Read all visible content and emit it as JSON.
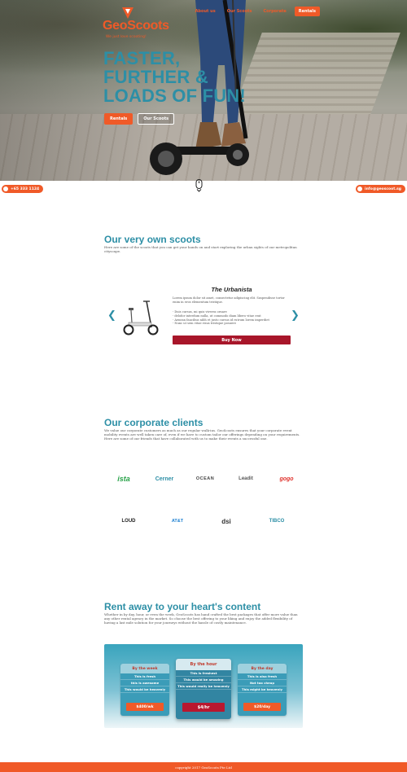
{
  "brand": {
    "name": "GeoScoots",
    "tagline": "We just love scooting!"
  },
  "nav": {
    "about": "About us",
    "scoots": "Our Scoots",
    "corporate": "Corporate",
    "rentals": "Rentals"
  },
  "hero": {
    "title_lines": [
      "FASTER,",
      "FURTHER &",
      "LOADS OF FUN!"
    ],
    "btn_rentals": "Rentals",
    "btn_scoots": "Our Scoots"
  },
  "contact": {
    "phone": "+65 333 1124",
    "email": "info@geoscoot.sg"
  },
  "scoots": {
    "title": "Our very own scoots",
    "text": "Here are some of the scoots that you can get your hands on and start exploring the urban sights of our metropolitan cityscape.",
    "product": {
      "name": "The Urbanista",
      "desc": "Lorem ipsum dolor sit amet, consectetur adipiscing elit. Suspendisse tortor enim in eros elementum tristique.",
      "features": [
        "- Duis cursus, mi quis viverra ornare",
        "- delofor interdum nulla, ut commodo diam libero vitae erat",
        "- Aenean faucibus nibh et justo cursus id rutrum lorem imperdiet",
        "- Nunc ut sem vitae risus tristique posuere"
      ],
      "buy": "Buy Now"
    }
  },
  "clients": {
    "title": "Our corporate clients",
    "text": "We value our corporate customers as much as our regular walk-ins. GeoScoots ensures that your corporate event mobility events are well taken care of, even if we have to custom tailor our offerings depending on your requirements. Here are some of our friends that have collaborated with us to make their events a successful one.",
    "logos": [
      "ista",
      "Cerner",
      "OCEAN",
      "Leadit",
      "gogo",
      "LOUD",
      "AT&T",
      "dsi",
      "TIBCO"
    ]
  },
  "rent": {
    "title": "Rent away to your heart's content",
    "text": "Whether in by day, hour, or even the week, GeoScoots has hand crafted the best packages that offer more value than any other rental agency in the market. So choose the best offering to your liking and enjoy the added flexibility of having a last mile solution for your journeys without the hassle of costly maintenance.",
    "plans": [
      {
        "name": "By the week",
        "rows": [
          "This is fresh",
          "this is awesome",
          "This would be heavenly"
        ],
        "price": "$400/wk"
      },
      {
        "name": "By the hour",
        "rows": [
          "This is freshest",
          "This would be amazing",
          "This would really be heavenly"
        ],
        "price": "$4/hr"
      },
      {
        "name": "By the day",
        "rows": [
          "This is also fresh",
          "Not too cheap",
          "This might be heavenly"
        ],
        "price": "$20/day"
      }
    ]
  },
  "footer": {
    "text": "copyright 2017 GeoScoots Pte Ltd"
  },
  "colors": {
    "accent": "#f05a28",
    "teal": "#2d8fa6",
    "buy": "#a8162a"
  }
}
